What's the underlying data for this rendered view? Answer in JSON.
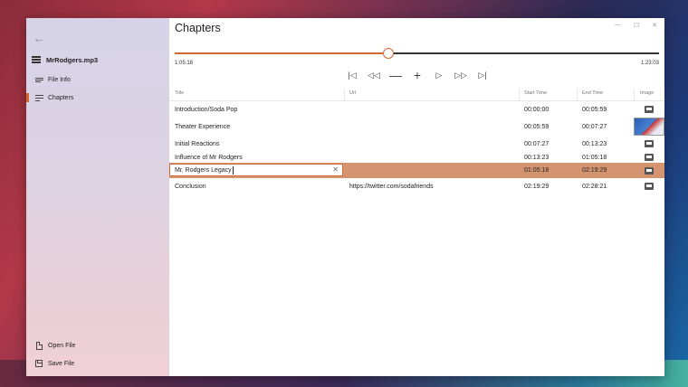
{
  "sidebar": {
    "filename": "MrRodgers.mp3",
    "nav": [
      {
        "label": "File Info",
        "icon": "info-lines-icon",
        "selected": false
      },
      {
        "label": "Chapters",
        "icon": "chapters-list-icon",
        "selected": true
      }
    ],
    "bottom": [
      {
        "label": "Open File",
        "icon": "open-file-icon"
      },
      {
        "label": "Save File",
        "icon": "save-file-icon"
      }
    ]
  },
  "main": {
    "title": "Chapters",
    "window_controls": {
      "minimize": "—",
      "maximize": "☐",
      "close": "✕"
    },
    "player": {
      "current_time": "1:05:18",
      "total_time": "1:23:03",
      "progress": 0.4406,
      "controls": [
        {
          "name": "skip-start-icon",
          "glyph": "|◁"
        },
        {
          "name": "rewind-icon",
          "glyph": "◁◁"
        },
        {
          "name": "remove-chapter-icon",
          "glyph": "—"
        },
        {
          "name": "add-chapter-icon",
          "glyph": "+"
        },
        {
          "name": "play-icon",
          "glyph": "▷"
        },
        {
          "name": "fast-forward-icon",
          "glyph": "▷▷"
        },
        {
          "name": "skip-end-icon",
          "glyph": "▷|"
        }
      ]
    },
    "table": {
      "columns": {
        "title": "Title",
        "url": "Url",
        "start": "Start Time",
        "end": "End Time",
        "image": "Image"
      },
      "rows": [
        {
          "title": "Introduction/Soda Pop",
          "url": "",
          "start": "00:00:00",
          "end": "00:05:59",
          "image": "image-icon"
        },
        {
          "title": "Theater Experience",
          "url": "",
          "start": "00:05:59",
          "end": "00:07:27",
          "image": "thumbnail"
        },
        {
          "title": "Initial Reactions",
          "url": "",
          "start": "00:07:27",
          "end": "00:13:23",
          "image": "image-icon"
        },
        {
          "title": "Influence of Mr Rodgers",
          "url": "",
          "start": "00:13:23",
          "end": "01:05:18",
          "image": "image-icon"
        },
        {
          "title": "Mr. Rodgers Legacy",
          "url": "",
          "start": "01:05:18",
          "end": "02:19:29",
          "image": "image-icon",
          "selected": true,
          "editing": true
        },
        {
          "title": "Conclusion",
          "url": "https://twitter.com/sodafriends",
          "start": "02:19:29",
          "end": "02:28:21",
          "image": "image-icon"
        }
      ]
    },
    "accent_color": "#d2692f",
    "selected_row_color": "#d49470"
  }
}
